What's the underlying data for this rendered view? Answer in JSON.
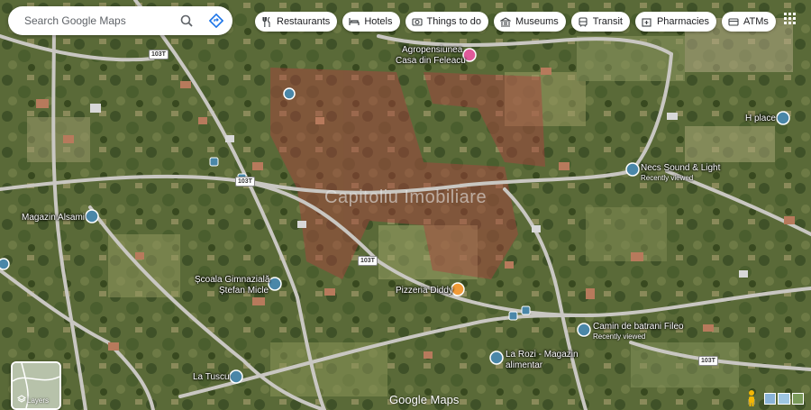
{
  "search": {
    "placeholder": "Search Google Maps"
  },
  "chips": [
    {
      "label": "Restaurants",
      "icon": "restaurant-icon"
    },
    {
      "label": "Hotels",
      "icon": "hotel-icon"
    },
    {
      "label": "Things to do",
      "icon": "camera-icon"
    },
    {
      "label": "Museums",
      "icon": "museum-icon"
    },
    {
      "label": "Transit",
      "icon": "transit-icon"
    },
    {
      "label": "Pharmacies",
      "icon": "pharmacy-icon"
    },
    {
      "label": "ATMs",
      "icon": "atm-icon"
    }
  ],
  "places": {
    "agropensiunea_l1": "Agropensiunea",
    "agropensiunea_l2": "Casa din Feleacu",
    "h_place": "H place",
    "necs": "Necs Sound & Light",
    "necs_sub": "Recently viewed",
    "magazin_alsami": "Magazin Alsami",
    "scoala_l1": "Școala Gimnazială",
    "scoala_l2": "Ștefan Micle",
    "pizzeria": "Pizzeria Diddy",
    "camin": "Camin de batrani Fileo",
    "camin_sub": "Recently viewed",
    "larozi_l1": "La Rozi - Magazin",
    "larozi_l2": "alimentar",
    "la_tuscu": "La Tuscu"
  },
  "roads": [
    "103T",
    "103T",
    "103T",
    "103T"
  ],
  "watermark": "Capitoliu Imobiliare",
  "layers_label": "Layers",
  "brand": "Google Maps",
  "colors": {
    "accent": "#1a73e8",
    "pin_blue": "#4a87a8",
    "pin_orange": "#f29b38",
    "pin_pink": "#e05a9a"
  }
}
